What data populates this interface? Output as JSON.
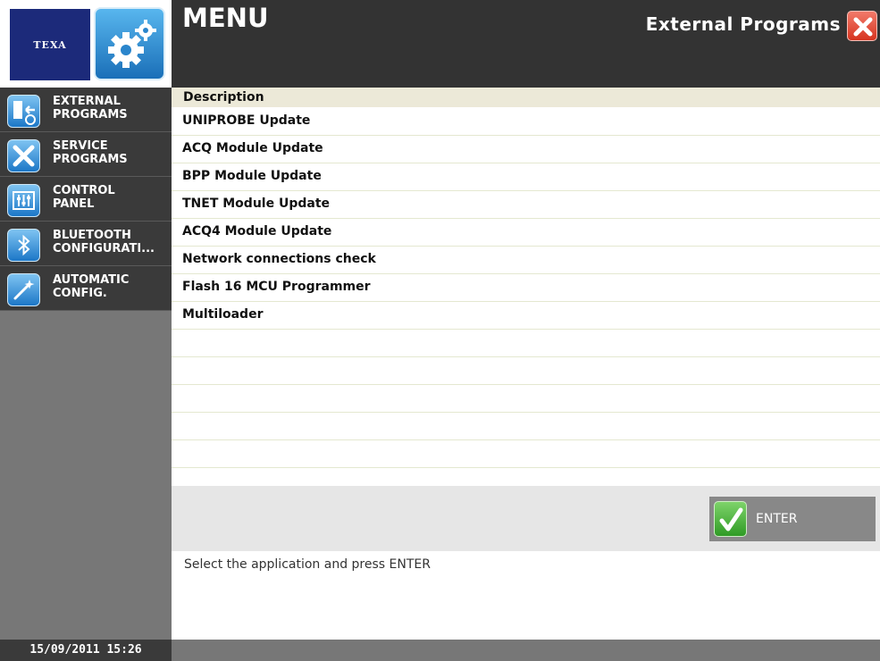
{
  "header": {
    "logo_text": "TEXA",
    "title": "MENU",
    "section_title": "External Programs",
    "app_icon": "gear-icon",
    "close_icon": "close-icon"
  },
  "sidebar": {
    "items": [
      {
        "line1": "EXTERNAL",
        "line2": "PROGRAMS",
        "icon": "external-programs-icon"
      },
      {
        "line1": "SERVICE",
        "line2": "PROGRAMS",
        "icon": "tools-icon"
      },
      {
        "line1": "CONTROL",
        "line2": "PANEL",
        "icon": "sliders-icon"
      },
      {
        "line1": "BLUETOOTH",
        "line2": "CONFIGURATI...",
        "icon": "bluetooth-icon"
      },
      {
        "line1": "AUTOMATIC",
        "line2": "CONFIG.",
        "icon": "magic-wand-icon"
      }
    ],
    "datetime": "15/09/2011 15:26"
  },
  "table": {
    "header": "Description",
    "rows": [
      "UNIPROBE Update",
      "ACQ Module Update",
      "BPP Module Update",
      "TNET Module Update",
      "ACQ4 Module Update",
      "Network connections check",
      "Flash 16 MCU Programmer",
      "Multiloader"
    ]
  },
  "actions": {
    "enter_label": "ENTER",
    "enter_icon": "checkmark-icon"
  },
  "instruction": "Select the application and press ENTER",
  "colors": {
    "header_bg": "#333333",
    "sidebar_bg": "#777777",
    "nav_item_bg": "#3a3a3a",
    "table_header_bg": "#ece9d8",
    "accent_blue": "#1c77c7",
    "close_red": "#d63420",
    "enter_green": "#2f9b25"
  }
}
